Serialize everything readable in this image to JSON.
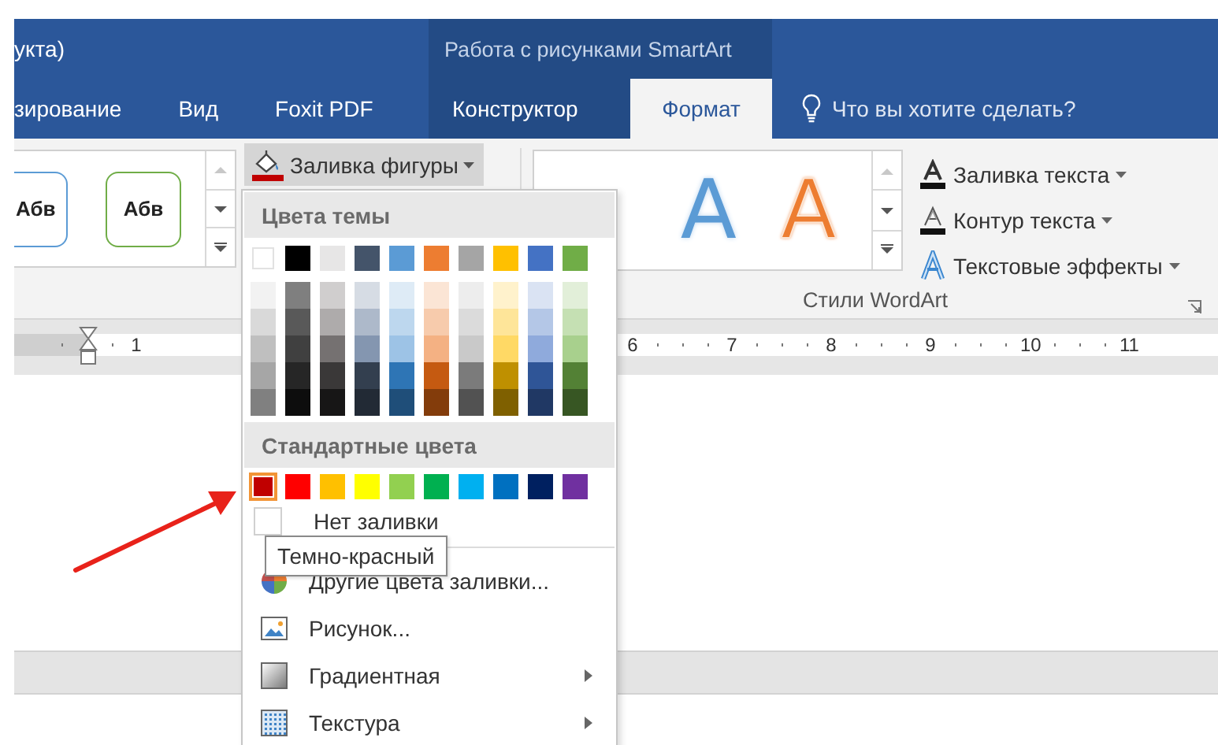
{
  "title_bar": {
    "title": "укта)",
    "context_group": "Работа с рисунками SmartArt"
  },
  "tabs": [
    {
      "label": "зирование",
      "kind": "normal",
      "selected": false
    },
    {
      "label": "Вид",
      "kind": "normal",
      "selected": false
    },
    {
      "label": "Foxit PDF",
      "kind": "normal",
      "selected": false
    },
    {
      "label": "Конструктор",
      "kind": "context",
      "selected": false
    },
    {
      "label": "Формат",
      "kind": "context",
      "selected": true
    }
  ],
  "tell_me": {
    "placeholder": "Что вы хотите сделать?"
  },
  "ribbon": {
    "shape_styles": [
      {
        "label": "Абв",
        "color": "#5b9bd5"
      },
      {
        "label": "Абв",
        "color": "#70ad47"
      }
    ],
    "shape_fill_button": {
      "label": "Заливка фигуры",
      "open": true
    },
    "wordart_styles": [
      {
        "label": "A",
        "kind": "fill",
        "color": "#5b9bd5"
      },
      {
        "label": "A",
        "kind": "outline",
        "color": "#ed7d31"
      }
    ],
    "text_commands": [
      {
        "label": "Заливка текста",
        "kind": "fill"
      },
      {
        "label": "Контур текста",
        "kind": "outline"
      },
      {
        "label": "Текстовые эффекты",
        "kind": "effects"
      }
    ],
    "group_label": "Стили WordArt"
  },
  "ruler": [
    "1",
    "6",
    "7",
    "8",
    "9",
    "10",
    "11"
  ],
  "fill_menu": {
    "theme_title": "Цвета темы",
    "theme_colors": [
      {
        "color": "#ffffff",
        "selected": false
      },
      {
        "color": "#000000",
        "selected": false
      },
      {
        "color": "#e7e6e6",
        "selected": false
      },
      {
        "color": "#44546a",
        "selected": false
      },
      {
        "color": "#5b9bd5",
        "selected": false
      },
      {
        "color": "#ed7d31",
        "selected": false
      },
      {
        "color": "#a5a5a5",
        "selected": false
      },
      {
        "color": "#ffc000",
        "selected": false
      },
      {
        "color": "#4472c4",
        "selected": false
      },
      {
        "color": "#70ad47",
        "selected": false
      }
    ],
    "theme_shades": [
      [
        {
          "color": "#f2f2f2",
          "selected": false
        },
        {
          "color": "#7f7f7f",
          "selected": false
        },
        {
          "color": "#d0cece",
          "selected": false
        },
        {
          "color": "#d6dce4",
          "selected": false
        },
        {
          "color": "#deebf6",
          "selected": false
        },
        {
          "color": "#fbe5d5",
          "selected": false
        },
        {
          "color": "#ededed",
          "selected": false
        },
        {
          "color": "#fff2cc",
          "selected": false
        },
        {
          "color": "#dae3f3",
          "selected": false
        },
        {
          "color": "#e2efd9",
          "selected": false
        }
      ],
      [
        {
          "color": "#d9d9d9",
          "selected": false
        },
        {
          "color": "#595959",
          "selected": false
        },
        {
          "color": "#aeabab",
          "selected": false
        },
        {
          "color": "#adb9ca",
          "selected": false
        },
        {
          "color": "#bdd7ee",
          "selected": false
        },
        {
          "color": "#f7cbac",
          "selected": false
        },
        {
          "color": "#dbdbdb",
          "selected": false
        },
        {
          "color": "#fee599",
          "selected": false
        },
        {
          "color": "#b4c7e7",
          "selected": false
        },
        {
          "color": "#c5e0b3",
          "selected": false
        }
      ],
      [
        {
          "color": "#bfbfbf",
          "selected": false
        },
        {
          "color": "#404040",
          "selected": false
        },
        {
          "color": "#757171",
          "selected": false
        },
        {
          "color": "#8496b0",
          "selected": false
        },
        {
          "color": "#9dc3e6",
          "selected": false
        },
        {
          "color": "#f4b183",
          "selected": false
        },
        {
          "color": "#c9c9c9",
          "selected": false
        },
        {
          "color": "#ffd965",
          "selected": false
        },
        {
          "color": "#8faadc",
          "selected": false
        },
        {
          "color": "#a8d08d",
          "selected": false
        }
      ],
      [
        {
          "color": "#a6a6a6",
          "selected": false
        },
        {
          "color": "#262626",
          "selected": false
        },
        {
          "color": "#3a3838",
          "selected": false
        },
        {
          "color": "#333f4f",
          "selected": false
        },
        {
          "color": "#2e75b5",
          "selected": false
        },
        {
          "color": "#c55a11",
          "selected": false
        },
        {
          "color": "#7b7b7b",
          "selected": false
        },
        {
          "color": "#bf9000",
          "selected": false
        },
        {
          "color": "#2f5597",
          "selected": false
        },
        {
          "color": "#538135",
          "selected": false
        }
      ],
      [
        {
          "color": "#808080",
          "selected": false
        },
        {
          "color": "#0d0d0d",
          "selected": false
        },
        {
          "color": "#171616",
          "selected": false
        },
        {
          "color": "#222a35",
          "selected": false
        },
        {
          "color": "#1f4e79",
          "selected": false
        },
        {
          "color": "#833c0b",
          "selected": false
        },
        {
          "color": "#525252",
          "selected": false
        },
        {
          "color": "#7f6000",
          "selected": false
        },
        {
          "color": "#203864",
          "selected": false
        },
        {
          "color": "#375623",
          "selected": false
        }
      ]
    ],
    "standard_title": "Стандартные цвета",
    "standard_colors": [
      {
        "color": "#c00000",
        "selected": true
      },
      {
        "color": "#ff0000",
        "selected": false
      },
      {
        "color": "#ffc000",
        "selected": false
      },
      {
        "color": "#ffff00",
        "selected": false
      },
      {
        "color": "#92d050",
        "selected": false
      },
      {
        "color": "#00b050",
        "selected": false
      },
      {
        "color": "#00b0f0",
        "selected": false
      },
      {
        "color": "#0070c0",
        "selected": false
      },
      {
        "color": "#002060",
        "selected": false
      },
      {
        "color": "#7030a0",
        "selected": false
      }
    ],
    "no_fill": "Нет заливки",
    "items": [
      {
        "label": "Другие цвета заливки...",
        "kind": "palette",
        "submenu": false
      },
      {
        "label": "Рисунок...",
        "kind": "picture",
        "submenu": false
      },
      {
        "label": "Градиентная",
        "kind": "gradient",
        "submenu": true
      },
      {
        "label": "Текстура",
        "kind": "texture",
        "submenu": true
      }
    ]
  },
  "tooltip": "Темно-красный"
}
